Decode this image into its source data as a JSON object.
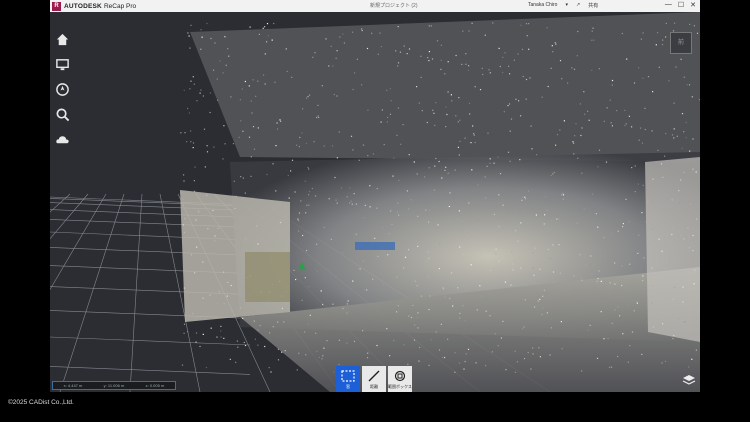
{
  "app": {
    "logo_letter": "R",
    "brand": "AUTODESK",
    "product": "ReCap Pro",
    "document_title": "新規プロジェクト (2)",
    "user_name": "Tanaka Chiro",
    "share_label": "共有",
    "accent_color": "#9c1a4d"
  },
  "window_controls": {
    "minimize": "—",
    "maximize": "☐",
    "close": "✕"
  },
  "left_toolbar": {
    "items": [
      {
        "icon": "home-icon"
      },
      {
        "icon": "display-settings-icon"
      },
      {
        "icon": "navigation-icon"
      },
      {
        "icon": "search-icon"
      },
      {
        "icon": "cloud-icon"
      }
    ]
  },
  "viewcube": {
    "label": "前"
  },
  "status_bar": {
    "x": "x: 4.447 m",
    "y": "y: 11.006 m",
    "z": "z: 0.005 m"
  },
  "bottom_tools": {
    "select_label": "窓",
    "measure_label": "距離",
    "limitbox_label": "範囲ボックス"
  },
  "copyright": "©2025 CADist Co.,Ltd."
}
